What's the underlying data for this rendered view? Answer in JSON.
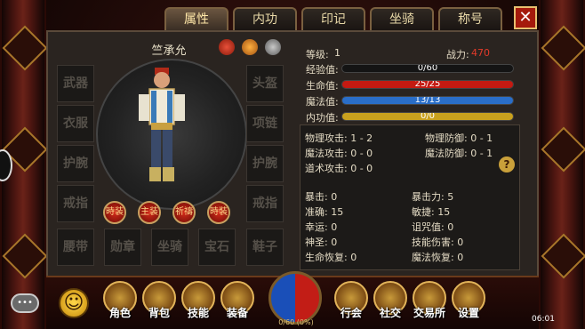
{
  "tabs": [
    {
      "label": "属性",
      "active": true
    },
    {
      "label": "内功",
      "active": false
    },
    {
      "label": "印记",
      "active": false
    },
    {
      "label": "坐骑",
      "active": false
    },
    {
      "label": "称号",
      "active": false
    }
  ],
  "close_label": "✕",
  "character": {
    "name": "竺承允",
    "equipment_slots": {
      "left": [
        "武器",
        "衣服",
        "护腕",
        "戒指",
        "腰带"
      ],
      "right": [
        "头盔",
        "项链",
        "护腕",
        "戒指",
        "鞋子"
      ],
      "bottom": [
        "勋章",
        "坐骑",
        "宝石"
      ]
    },
    "quick_buttons": [
      "時装",
      "主装",
      "祈禱",
      "時裝"
    ]
  },
  "stats": {
    "level_label": "等级:",
    "level": "1",
    "power_label": "战力:",
    "power": "470",
    "exp_label": "经验值:",
    "exp_text": "0/60",
    "exp_fraction": 0.0,
    "hp_label": "生命值:",
    "hp_text": "25/25",
    "hp_fraction": 1.0,
    "mp_label": "魔法值:",
    "mp_text": "13/13",
    "mp_fraction": 1.0,
    "ip_label": "内功值:",
    "ip_text": "0/0",
    "ip_fraction": 1.0
  },
  "attributes": [
    {
      "left": "物理攻击: 1 - 2",
      "right": "物理防御: 0 - 1"
    },
    {
      "left": "魔法攻击: 0 - 0",
      "right": "魔法防御: 0 - 1"
    },
    {
      "left": "道术攻击: 0 - 0",
      "right": ""
    },
    {
      "left": "暴击: 0",
      "right": "暴击力: 5"
    },
    {
      "left": "准确: 15",
      "right": "敏捷: 15"
    },
    {
      "left": "幸运: 0",
      "right": "诅咒值: 0"
    },
    {
      "left": "神圣: 0",
      "right": "技能伤害: 0"
    },
    {
      "left": "生命恢复: 0",
      "right": "魔法恢复: 0"
    }
  ],
  "help_label": "?",
  "bottom_menu": {
    "left": [
      "角色",
      "背包",
      "技能",
      "装备"
    ],
    "right": [
      "行会",
      "社交",
      "交易所",
      "设置"
    ]
  },
  "exp_orb_text": "0/60 (0%)",
  "chat_label": "•••",
  "emoji_label": "☺",
  "clock": "06:01",
  "colors": {
    "hp": "#c41a12",
    "mp": "#2a6ec8",
    "inner": "#c9a11e",
    "exp": "#d8b040",
    "power": "#e23a2a"
  }
}
